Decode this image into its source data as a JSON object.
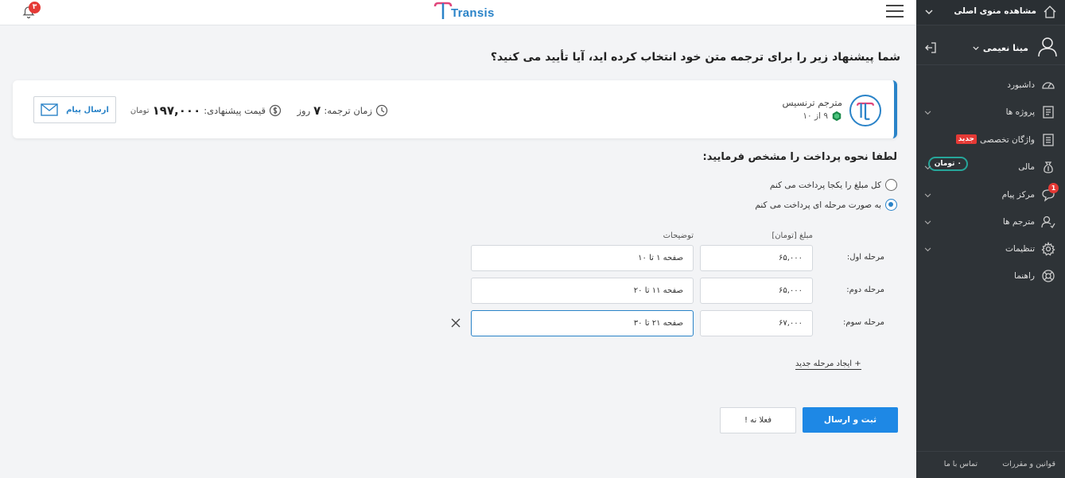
{
  "topbar": {
    "notifications_count": "۳",
    "brand": "Transis"
  },
  "offer": {
    "question": "شما پیشنهاد زیر را برای ترجمه متن خود انتخاب کرده اید، آیا تأیید می کنید؟",
    "translator_name": "مترجم ترنسیس",
    "rating": "۹ از ۱۰",
    "time_label": "زمان ترجمه:",
    "time_value": "۷",
    "time_unit": "روز",
    "price_label": "قیمت پیشنهادی:",
    "price_value": "۱۹۷,۰۰۰",
    "price_unit": "تومان",
    "send_message": "ارسال پیام"
  },
  "payment": {
    "title": "لطفا نحوه پرداخت را مشخص فرمایید:",
    "options": [
      {
        "label": "کل مبلغ را یکجا پرداخت می کنم",
        "checked": false
      },
      {
        "label": "به صورت مرحله ای پرداخت می کنم",
        "checked": true
      }
    ],
    "col_amount": "مبلغ [تومان]",
    "col_desc": "توضیحات",
    "stages": [
      {
        "label": "مرحله اول:",
        "amount": "۶۵,۰۰۰",
        "desc": "صفحه ۱ تا ۱۰"
      },
      {
        "label": "مرحله دوم:",
        "amount": "۶۵,۰۰۰",
        "desc": "صفحه ۱۱ تا ۲۰"
      },
      {
        "label": "مرحله سوم:",
        "amount": "۶۷,۰۰۰",
        "desc": "صفحه ۲۱ تا ۳۰"
      }
    ],
    "add_stage": "+ ایجاد مرحله جدید",
    "submit": "ثبت و ارسال",
    "later": "فعلا نه !"
  },
  "sidebar": {
    "main_menu": "مشاهده منوی اصلی",
    "user_name": "مینا نعیمی",
    "items": [
      {
        "label": "داشبورد",
        "icon": "dashboard-icon"
      },
      {
        "label": "پروژه ها",
        "icon": "projects-icon"
      },
      {
        "label": "واژگان تخصصی",
        "icon": "glossary-icon",
        "badge": "جدید"
      },
      {
        "label": "مالی",
        "icon": "finance-icon",
        "badge": "۰ تومان"
      },
      {
        "label": "مرکز پیام",
        "icon": "messages-icon",
        "badge": "1"
      },
      {
        "label": "مترجم ها",
        "icon": "translators-icon"
      },
      {
        "label": "تنظیمات",
        "icon": "settings-icon"
      },
      {
        "label": "راهنما",
        "icon": "help-icon"
      }
    ],
    "footer_rules": "قوانین و مقررات",
    "footer_contact": "تماس با ما"
  },
  "colors": {
    "accent": "#1e88e5",
    "sidebar_bg": "#2e3337",
    "badge_red": "#e53935",
    "toman_border": "#26a69a"
  }
}
